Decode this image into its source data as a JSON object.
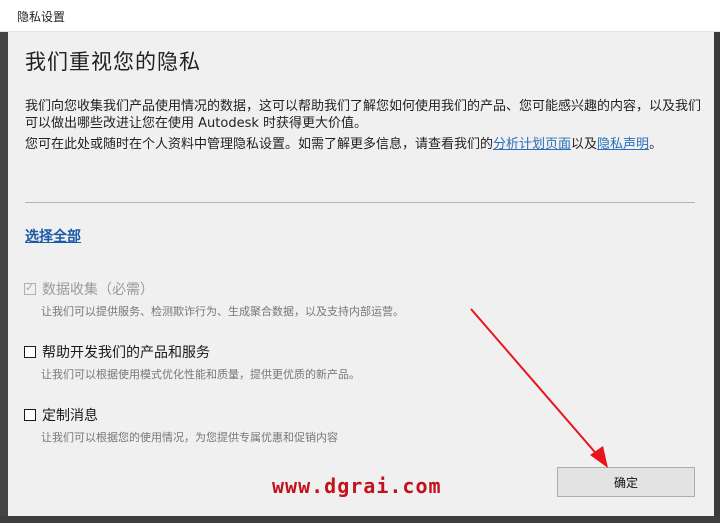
{
  "window": {
    "title": "隐私设置"
  },
  "main": {
    "heading": "我们重视您的隐私",
    "paragraph1": "我们向您收集我们产品使用情况的数据，这可以帮助我们了解您如何使用我们的产品、您可能感兴趣的内容，以及我们可以做出哪些改进让您在使用 Autodesk 时获得更大价值。",
    "paragraph2_before": "您可在此处或随时在个人资料中管理隐私设置。如需了解更多信息，请查看我们的",
    "paragraph2_link1": "分析计划页面",
    "paragraph2_mid": "以及",
    "paragraph2_link2": "隐私声明",
    "paragraph2_after": "。",
    "select_all": "选择全部"
  },
  "options": [
    {
      "label": "数据收集（必需）",
      "description": "让我们可以提供服务、检测欺诈行为、生成聚合数据，以及支持内部运营。",
      "checked": true,
      "disabled": true
    },
    {
      "label": "帮助开发我们的产品和服务",
      "description": "让我们可以根据使用模式优化性能和质量，提供更优质的新产品。",
      "checked": false,
      "disabled": false
    },
    {
      "label": "定制消息",
      "description": "让我们可以根据您的使用情况，为您提供专属优惠和促销内容",
      "checked": false,
      "disabled": false
    }
  ],
  "footer": {
    "ok_label": "确定",
    "watermark": "www.dgrai.com"
  },
  "colors": {
    "link": "#2a6fbb",
    "annotation_red": "#e8141c",
    "watermark_red": "#c2121c"
  }
}
